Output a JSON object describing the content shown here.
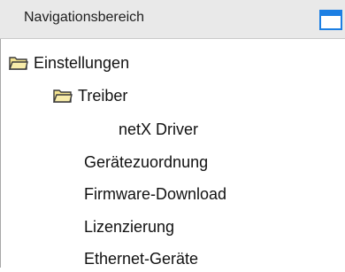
{
  "panel": {
    "title": "Navigationsbereich",
    "window_icon": "window-icon"
  },
  "tree": {
    "items": [
      {
        "label": "Einstellungen",
        "icon": "folder-open-icon",
        "level": 0
      },
      {
        "label": "Treiber",
        "icon": "folder-open-icon",
        "level": 1
      },
      {
        "label": "netX Driver",
        "icon": null,
        "level": 2
      },
      {
        "label": "Gerätezuordnung",
        "icon": null,
        "level": 1
      },
      {
        "label": "Firmware-Download",
        "icon": null,
        "level": 1
      },
      {
        "label": "Lizenzierung",
        "icon": null,
        "level": 1
      },
      {
        "label": "Ethernet-Geräte",
        "icon": null,
        "level": 1
      }
    ]
  },
  "colors": {
    "accent": "#1c7fe3",
    "header_bg": "#e9e9e9",
    "folder_fill": "#f3e38f",
    "folder_outline": "#3a3a3a"
  }
}
